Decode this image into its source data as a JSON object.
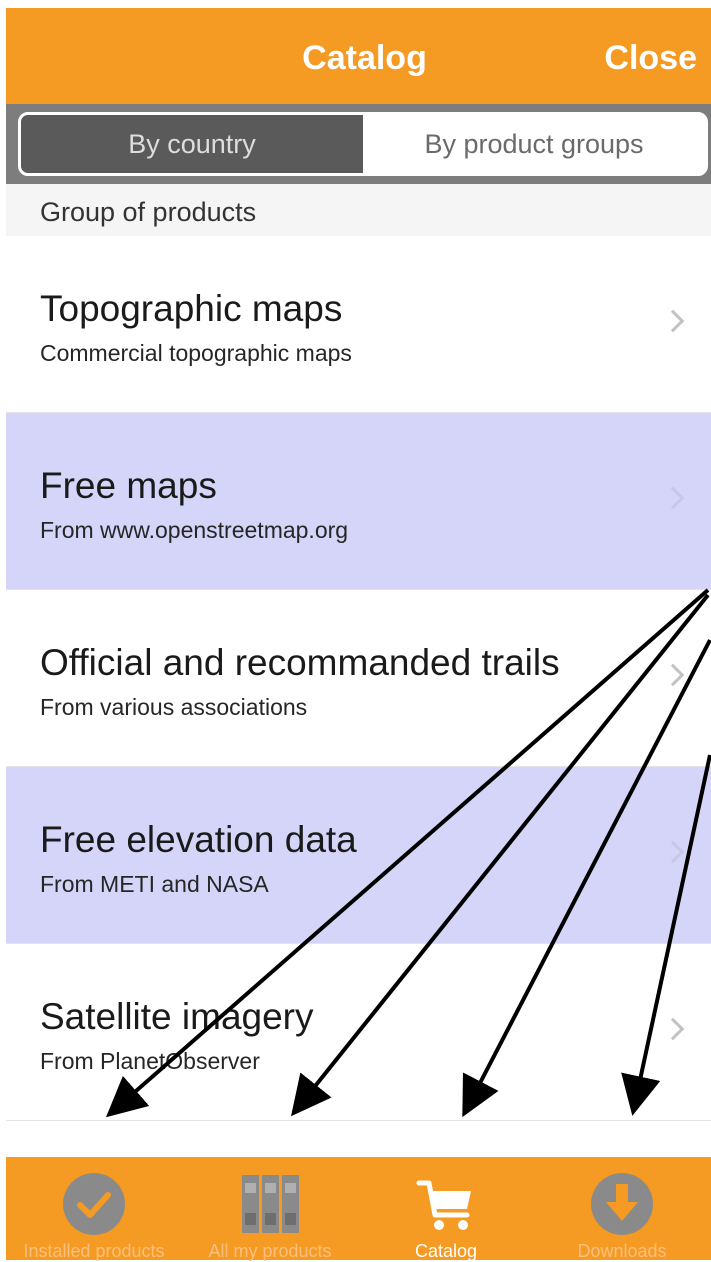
{
  "navbar": {
    "title": "Catalog",
    "close_label": "Close"
  },
  "segments": {
    "by_country": "By country",
    "by_groups": "By product groups",
    "selected": "By country"
  },
  "section_header": "Group of products",
  "rows": [
    {
      "title": "Topographic maps",
      "subtitle": "Commercial topographic maps",
      "highlighted": false
    },
    {
      "title": "Free maps",
      "subtitle": "From www.openstreetmap.org",
      "highlighted": true
    },
    {
      "title": "Official and recommanded trails",
      "subtitle": "From various associations",
      "highlighted": false
    },
    {
      "title": "Free elevation data",
      "subtitle": "From METI and NASA",
      "highlighted": true
    },
    {
      "title": "Satellite imagery",
      "subtitle": "From PlanetObserver",
      "highlighted": false
    }
  ],
  "tabs": [
    {
      "label": "Installed products",
      "icon": "checkmark-circle-icon",
      "selected": false
    },
    {
      "label": "All my products",
      "icon": "binders-icon",
      "selected": false
    },
    {
      "label": "Catalog",
      "icon": "shopping-cart-icon",
      "selected": true
    },
    {
      "label": "Downloads",
      "icon": "download-arrow-circle-icon",
      "selected": false
    }
  ],
  "colors": {
    "accent_orange": "#f59a23",
    "row_highlight": "#d5d5f9",
    "segment_dark": "#5a5a5a",
    "tab_icon_inactive": "#8a8a8a",
    "annotation_arrow": "#000000"
  }
}
